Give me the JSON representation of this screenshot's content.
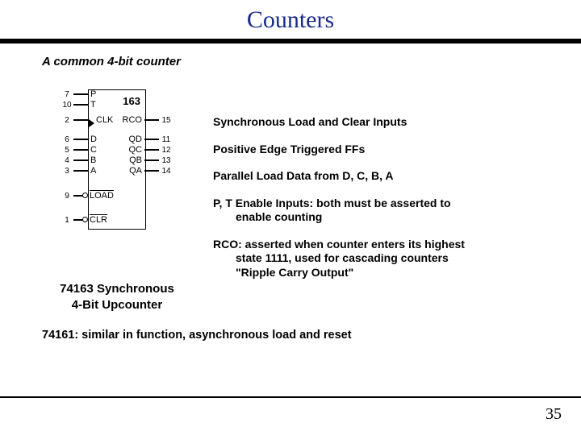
{
  "title": "Counters",
  "subtitle": "A common 4-bit counter",
  "chip": {
    "name": "163",
    "left_pins": [
      {
        "num": "7",
        "label": "P"
      },
      {
        "num": "10",
        "label": "T"
      },
      {
        "num": "2",
        "label": "CLK"
      },
      {
        "num": "6",
        "label": "D"
      },
      {
        "num": "5",
        "label": "C"
      },
      {
        "num": "4",
        "label": "B"
      },
      {
        "num": "3",
        "label": "A"
      },
      {
        "num": "9",
        "label": "LOAD"
      },
      {
        "num": "1",
        "label": "CLR"
      }
    ],
    "right_pins": [
      {
        "num": "15",
        "label": "RCO"
      },
      {
        "num": "11",
        "label": "QD"
      },
      {
        "num": "12",
        "label": "QC"
      },
      {
        "num": "13",
        "label": "QB"
      },
      {
        "num": "14",
        "label": "QA"
      }
    ]
  },
  "caption": {
    "line1": "74163 Synchronous",
    "line2": "4-Bit Upcounter"
  },
  "bullets": {
    "b1": "Synchronous Load and Clear Inputs",
    "b2": "Positive Edge Triggered FFs",
    "b3": "Parallel Load Data from D, C, B, A",
    "b4a": "P, T Enable Inputs: both must be asserted to",
    "b4b": "enable counting",
    "b5a": "RCO: asserted when counter enters its highest",
    "b5b": "state 1111, used for cascading counters",
    "b5c": "\"Ripple Carry Output\""
  },
  "bottom_note": "74161: similar in function, asynchronous load and reset",
  "page_number": "35"
}
